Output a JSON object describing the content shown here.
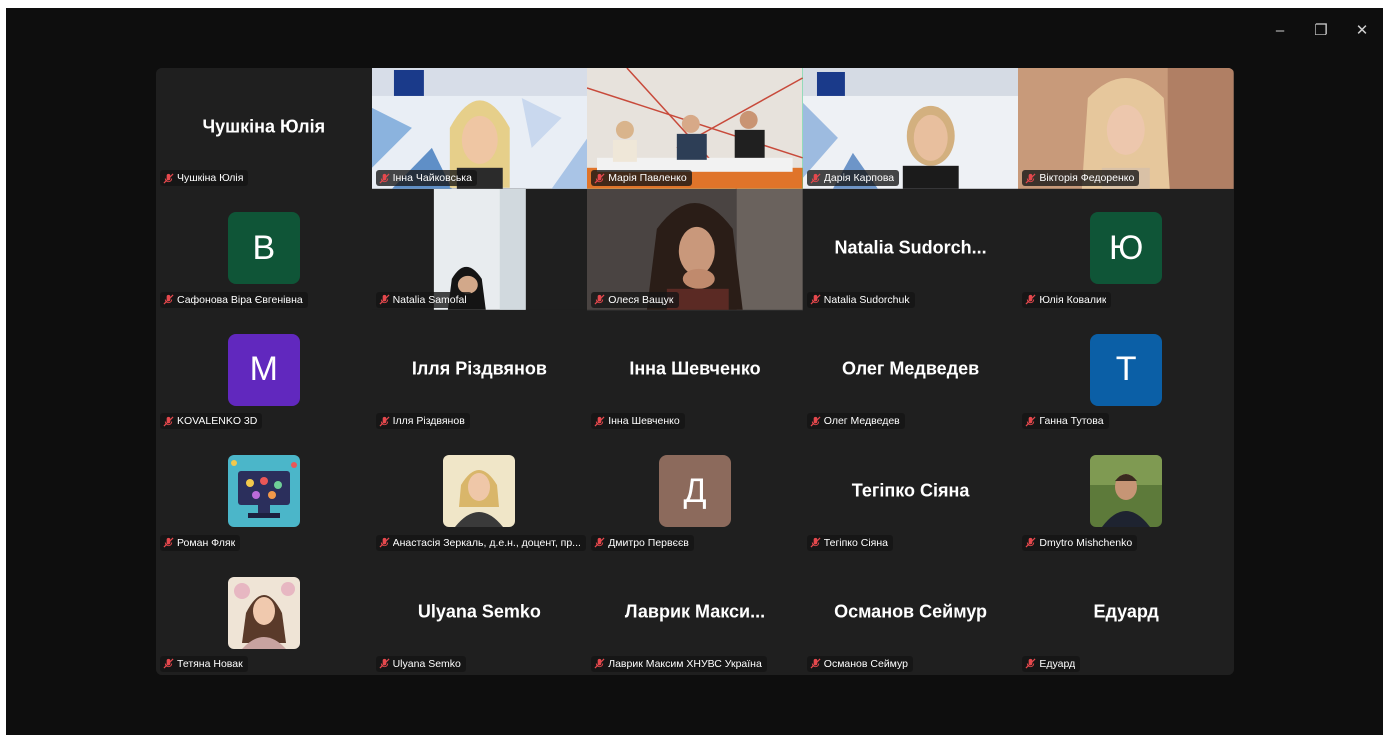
{
  "window": {
    "minimize_glyph": "–",
    "restore_glyph": "❐",
    "close_glyph": "✕"
  },
  "colors": {
    "active_speaker_border": "#23d18b",
    "muted_icon": "#e5484d"
  },
  "participants": [
    {
      "display": "Чушкіна Юлія",
      "label": "Чушкіна Юлія",
      "type": "name"
    },
    {
      "label": "Інна Чайковська",
      "type": "video"
    },
    {
      "label": "Марія Павленко",
      "type": "video",
      "active": true
    },
    {
      "label": "Дарія Карпова",
      "type": "video"
    },
    {
      "label": "Вікторія Федоренко",
      "type": "video"
    },
    {
      "initial": "В",
      "label": "Сафонова Віра Євгенівна",
      "type": "avatar",
      "color": "#0f5537"
    },
    {
      "label": "Natalia Samofal",
      "type": "video"
    },
    {
      "label": "Олеся Ващук",
      "type": "video"
    },
    {
      "display": "Natalia  Sudorch...",
      "label": "Natalia Sudorchuk",
      "type": "name"
    },
    {
      "initial": "Ю",
      "label": "Юлія Ковалик",
      "type": "avatar",
      "color": "#0f5537"
    },
    {
      "initial": "M",
      "label": "KOVALENKO 3D",
      "type": "avatar",
      "color": "#6128be"
    },
    {
      "display": "Ілля Різдвянов",
      "label": "Ілля Різдвянов",
      "type": "name"
    },
    {
      "display": "Інна Шевченко",
      "label": "Інна Шевченко",
      "type": "name"
    },
    {
      "display": "Олег Медведев",
      "label": "Олег Медведев",
      "type": "name"
    },
    {
      "initial": "T",
      "label": "Ганна Тутова",
      "type": "avatar",
      "color": "#0b5fa6"
    },
    {
      "label": "Роман Фляк",
      "type": "photo"
    },
    {
      "label": "Анастасія Зеркаль, д.е.н., доцент, пр...",
      "type": "photo"
    },
    {
      "initial": "Д",
      "label": "Дмитро Первєєв",
      "type": "avatar",
      "color": "#8c6a5c"
    },
    {
      "display": "Тегіпко Сіяна",
      "label": "Тегіпко Сіяна",
      "type": "name"
    },
    {
      "label": "Dmytro Mishchenko",
      "type": "photo"
    },
    {
      "label": "Тетяна Новак",
      "type": "photo"
    },
    {
      "display": "Ulyana Semko",
      "label": "Ulyana Semko",
      "type": "name"
    },
    {
      "display": "Лаврик  Макси...",
      "label": "Лаврик Максим ХНУВС Україна",
      "type": "name"
    },
    {
      "display": "Османов Сеймур",
      "label": "Османов Сеймур",
      "type": "name"
    },
    {
      "display": "Едуард",
      "label": "Едуард",
      "type": "name"
    }
  ]
}
